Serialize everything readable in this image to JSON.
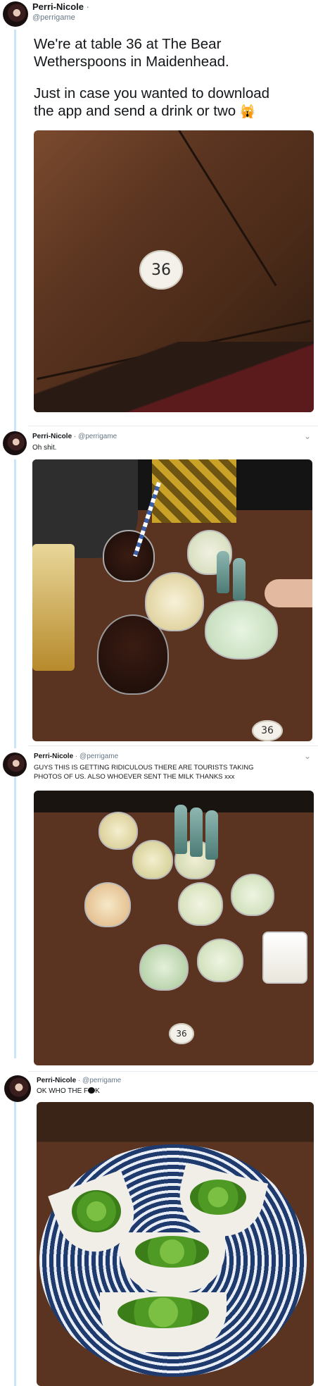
{
  "tweets": [
    {
      "name": "Perri-Nicole",
      "separator": "·",
      "handle": "@perrigame",
      "lines": [
        "We're at table 36 at The Bear",
        "Wetherspoons in Maidenhead.",
        "Just in case you wanted to download",
        "the app and send a drink or two"
      ],
      "emoji": "🙀",
      "table_number": "36"
    },
    {
      "name": "Perri-Nicole",
      "separator": "·",
      "handle": "@perrigame",
      "text": "Oh shit.",
      "table_number": "36"
    },
    {
      "name": "Perri-Nicole",
      "separator": "·",
      "handle": "@perrigame",
      "lines": [
        "GUYS THIS IS GETTING RIDICULOUS THERE ARE TOURISTS TAKING",
        "PHOTOS OF US. ALSO WHOEVER SENT THE MILK THANKS xxx"
      ],
      "table_number": "36"
    },
    {
      "name": "Perri-Nicole",
      "separator": "·",
      "handle": "@perrigame",
      "text_pre": "OK WHO THE F",
      "text_post": "K"
    }
  ],
  "icons": {
    "caret": "chevron-down-icon",
    "emoji": "cat-emoji-icon"
  },
  "colors": {
    "thread_line": "#c7e6f7",
    "handle": "#657786",
    "wood": "#5a3420"
  }
}
